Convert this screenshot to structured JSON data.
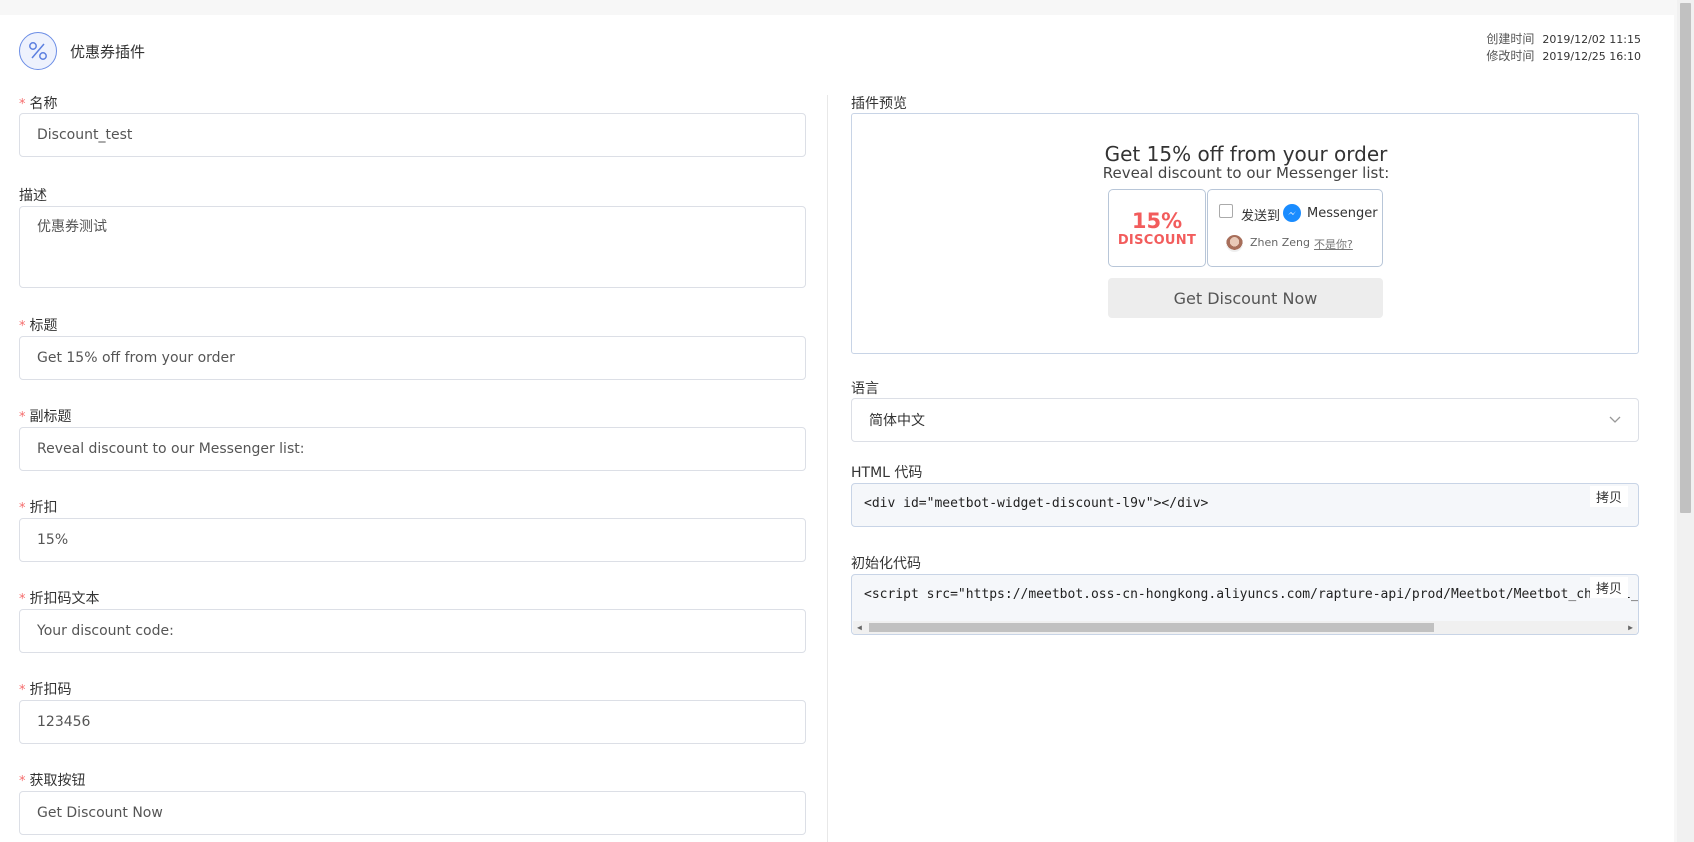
{
  "header": {
    "title": "优惠券插件",
    "icon": "percent-icon",
    "created_label": "创建时间",
    "created_value": "2019/12/02 11:15",
    "modified_label": "修改时间",
    "modified_value": "2019/12/25 16:10"
  },
  "form": {
    "name": {
      "label": "名称",
      "value": "Discount_test"
    },
    "description": {
      "label": "描述",
      "value": "优惠券测试"
    },
    "title": {
      "label": "标题",
      "value": "Get 15% off from your order"
    },
    "subtitle": {
      "label": "副标题",
      "value": "Reveal discount to our Messenger list:"
    },
    "discount": {
      "label": "折扣",
      "value": "15%"
    },
    "code_text": {
      "label": "折扣码文本",
      "value": "Your discount code:"
    },
    "code": {
      "label": "折扣码",
      "value": "123456"
    },
    "button": {
      "label": "获取按钮",
      "value": "Get Discount Now"
    }
  },
  "preview": {
    "label": "插件预览",
    "title": "Get 15% off from your order",
    "subtitle": "Reveal discount to our Messenger list:",
    "badge_pct": "15%",
    "badge_text": "DISCOUNT",
    "send_to": "发送到",
    "messenger": "Messenger",
    "user_name": "Zhen Zeng",
    "not_you": "不是你?",
    "button": "Get Discount Now",
    "colors": {
      "badge": "#f25c5c",
      "messenger": "#1a8cff"
    }
  },
  "language": {
    "label": "语言",
    "value": "简体中文"
  },
  "html_code": {
    "label": "HTML 代码",
    "value": "<div id=\"meetbot-widget-discount-l9v\"></div>",
    "copy": "拷贝"
  },
  "init_code": {
    "label": "初始化代码",
    "value": "<script src=\"https://meetbot.oss-cn-hongkong.aliyuncs.com/rapture-api/prod/Meetbot/Meetbot_channel_",
    "copy": "拷贝"
  }
}
